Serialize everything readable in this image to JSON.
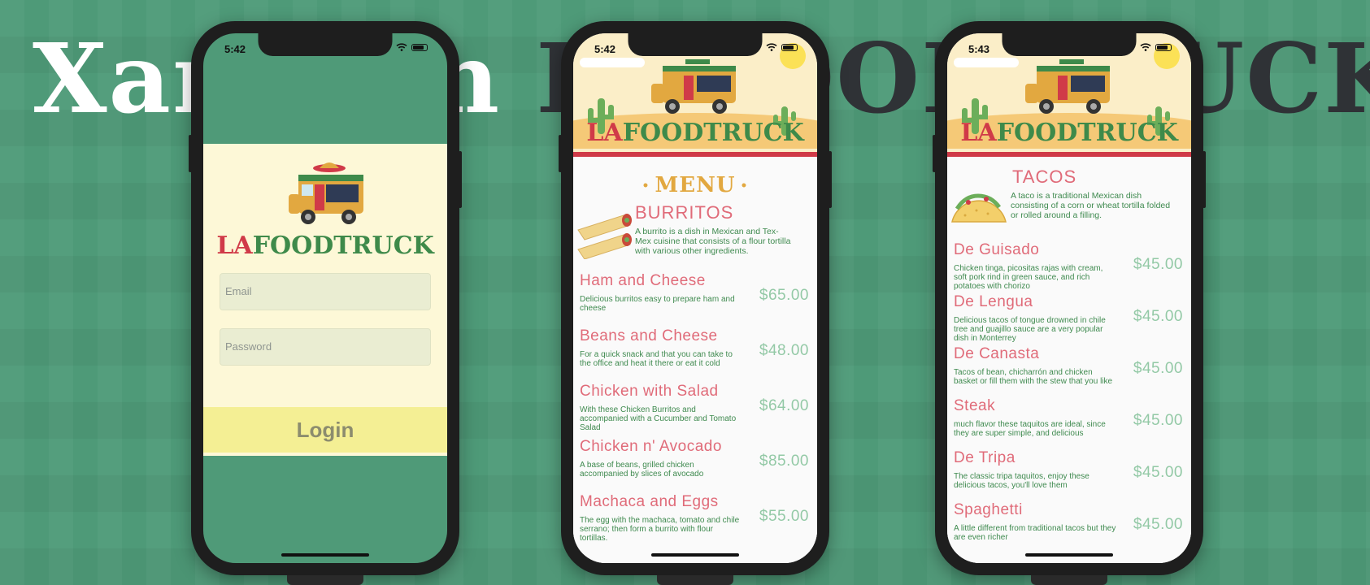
{
  "banner": {
    "word1": "Xamarin",
    "word2": "LAFOODTRUCK"
  },
  "brand": {
    "la": "LA",
    "foodtruck": "FOODTRUCK"
  },
  "colors": {
    "background": "#4e9a78",
    "brand_red": "#d03a48",
    "brand_green": "#3e8a4a",
    "item_pink": "#e06b79",
    "price_green": "#93c9a6",
    "login_button": "#f4ef94"
  },
  "login_screen": {
    "time": "5:42",
    "email_placeholder": "Email",
    "password_placeholder": "Password",
    "login_label": "Login"
  },
  "menu_screen": {
    "time": "5:42",
    "heading": "MENU",
    "category": {
      "title": "BURRITOS",
      "description": "A burrito is a dish in Mexican and Tex-Mex cuisine that consists of a flour tortilla with various other ingredients."
    },
    "items": [
      {
        "name": "Ham and Cheese",
        "description": "Delicious burritos easy to prepare ham and cheese",
        "price": "$65.00"
      },
      {
        "name": "Beans and Cheese",
        "description": "For a quick snack and that you can take to the office and heat it there or eat it cold",
        "price": "$48.00"
      },
      {
        "name": "Chicken with Salad",
        "description": "With these Chicken Burritos and accompanied with a Cucumber and Tomato Salad",
        "price": "$64.00"
      },
      {
        "name": "Chicken n' Avocado",
        "description": "A base of beans, grilled chicken accompanied by slices of avocado",
        "price": "$85.00"
      },
      {
        "name": "Machaca and Eggs",
        "description": "The egg with the machaca, tomato and chile serrano; then form a burrito with flour tortillas.",
        "price": "$55.00"
      }
    ]
  },
  "tacos_screen": {
    "time": "5:43",
    "category": {
      "title": "TACOS",
      "description": "A taco is a traditional Mexican dish consisting of a corn or wheat tortilla folded or rolled around a filling."
    },
    "items": [
      {
        "name": "De Guisado",
        "description": "Chicken tinga, picositas rajas with cream, soft pork rind in green sauce, and rich potatoes with chorizo",
        "price": "$45.00"
      },
      {
        "name": "De Lengua",
        "description": "Delicious tacos of tongue drowned in chile tree and guajillo sauce are a very popular dish in Monterrey",
        "price": "$45.00"
      },
      {
        "name": "De Canasta",
        "description": "Tacos of bean, chicharrón and chicken basket or fill them with the stew that you like",
        "price": "$45.00"
      },
      {
        "name": "Steak",
        "description": "much flavor these taquitos are ideal, since they are super simple, and delicious",
        "price": "$45.00"
      },
      {
        "name": "De Tripa",
        "description": "The classic tripa taquitos, enjoy these delicious tacos, you'll love them",
        "price": "$45.00"
      },
      {
        "name": "Spaghetti",
        "description": "A little different from traditional tacos but they are even richer",
        "price": "$45.00"
      }
    ]
  }
}
